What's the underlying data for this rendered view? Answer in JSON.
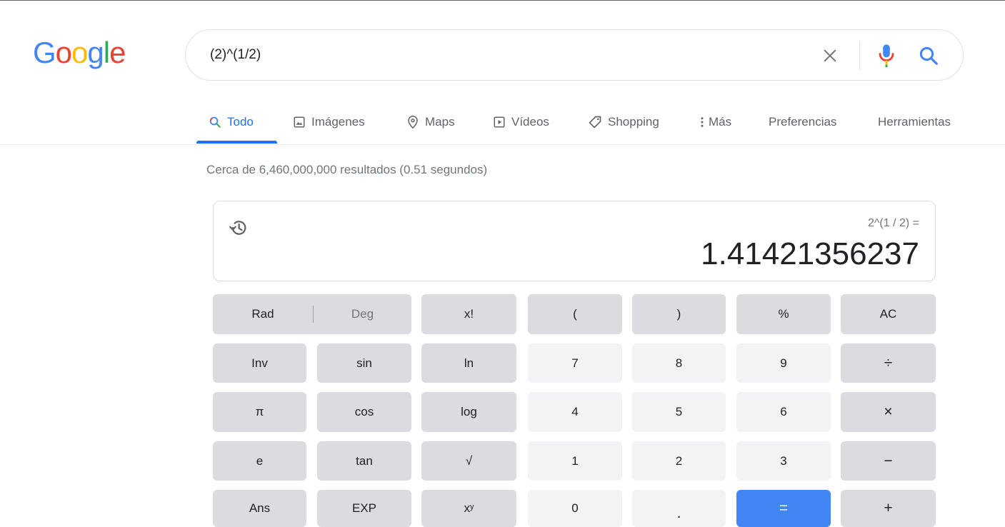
{
  "logo": {
    "letters": [
      "G",
      "o",
      "o",
      "g",
      "l",
      "e"
    ],
    "colors": [
      "#4285f4",
      "#ea4335",
      "#fbbc05",
      "#4285f4",
      "#34a853",
      "#ea4335"
    ]
  },
  "search": {
    "value": "(2)^(1/2)",
    "clear_icon": "close-icon",
    "mic_icon": "microphone-icon",
    "search_icon": "search-icon"
  },
  "tabs": {
    "all": "Todo",
    "images": "Imágenes",
    "maps": "Maps",
    "videos": "Vídeos",
    "shopping": "Shopping",
    "more": "Más",
    "settings": "Preferencias",
    "tools": "Herramientas"
  },
  "result_stats": "Cerca de 6,460,000,000 resultados (0.51 segundos)",
  "calculator": {
    "expression": "2^(1 / 2) =",
    "result": "1.41421356237",
    "keys": {
      "rad": "Rad",
      "deg": "Deg",
      "factorial": "x!",
      "paren_open": "(",
      "paren_close": ")",
      "percent": "%",
      "clear": "AC",
      "inv": "Inv",
      "sin": "sin",
      "ln": "ln",
      "seven": "7",
      "eight": "8",
      "nine": "9",
      "divide": "÷",
      "pi": "π",
      "cos": "cos",
      "log": "log",
      "four": "4",
      "five": "5",
      "six": "6",
      "multiply": "×",
      "e": "e",
      "tan": "tan",
      "sqrt": "√",
      "one": "1",
      "two": "2",
      "three": "3",
      "minus": "−",
      "ans": "Ans",
      "exp": "EXP",
      "power_base": "x",
      "power_exp": "y",
      "zero": "0",
      "dot": ".",
      "equals": "=",
      "plus": "+"
    }
  },
  "colors": {
    "accent": "#1a73e8",
    "key_dark": "#dadce0",
    "key_light": "#f1f3f4",
    "equals_key": "#4285f4"
  }
}
